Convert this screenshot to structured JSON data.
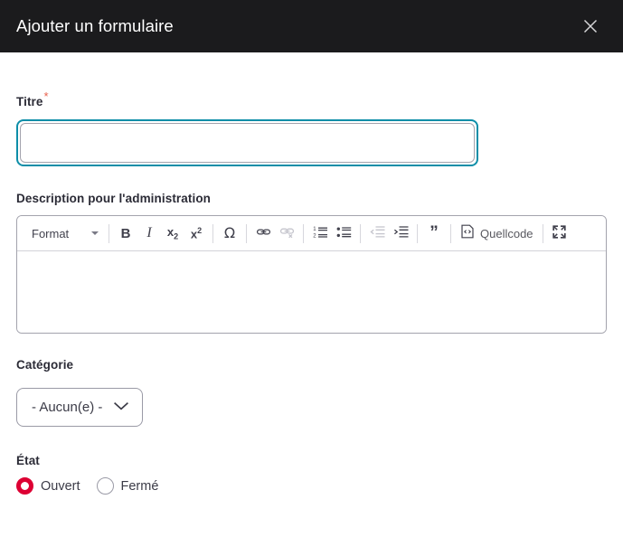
{
  "dialog": {
    "title": "Ajouter un formulaire",
    "close_label": "Fermer",
    "close_icon": "close-icon"
  },
  "colors": {
    "header_bg": "#1b1b1d",
    "focus_ring": "#0d8ea8",
    "required_star": "#e8604c",
    "radio_selected": "#dd0033",
    "border_grey": "#a3a3ad"
  },
  "form": {
    "title_field": {
      "label": "Titre",
      "required_marker": "*",
      "value": "",
      "placeholder": ""
    },
    "description_field": {
      "label": "Description pour l'administration",
      "value": "",
      "toolbar": {
        "format_label": "Format",
        "format_caret_icon": "chevron-down-icon",
        "buttons": [
          {
            "name": "bold",
            "label": "B",
            "icon": "bold-icon",
            "disabled": false
          },
          {
            "name": "italic",
            "label": "I",
            "icon": "italic-icon",
            "disabled": false
          },
          {
            "name": "subscript",
            "label": "x2",
            "icon": "subscript-icon",
            "disabled": false
          },
          {
            "name": "superscript",
            "label": "x2",
            "icon": "superscript-icon",
            "disabled": false
          },
          {
            "name": "special-char",
            "label": "Ω",
            "icon": "omega-icon",
            "disabled": false
          },
          {
            "name": "link",
            "label": "",
            "icon": "link-icon",
            "disabled": false
          },
          {
            "name": "unlink",
            "label": "",
            "icon": "unlink-icon",
            "disabled": true
          },
          {
            "name": "numbered-list",
            "label": "",
            "icon": "numbered-list-icon",
            "disabled": false
          },
          {
            "name": "bulleted-list",
            "label": "",
            "icon": "bulleted-list-icon",
            "disabled": false
          },
          {
            "name": "outdent",
            "label": "",
            "icon": "outdent-icon",
            "disabled": true
          },
          {
            "name": "indent",
            "label": "",
            "icon": "indent-icon",
            "disabled": false
          },
          {
            "name": "blockquote",
            "label": "”",
            "icon": "blockquote-icon",
            "disabled": false
          }
        ],
        "source_label": "Quellcode",
        "source_icon": "source-code-icon",
        "maximize_icon": "maximize-icon"
      }
    },
    "category_field": {
      "label": "Catégorie",
      "selected": "- Aucun(e) -",
      "caret_icon": "chevron-down-icon",
      "options": [
        "- Aucun(e) -"
      ]
    },
    "state_field": {
      "label": "État",
      "options": [
        {
          "label": "Ouvert",
          "selected": true
        },
        {
          "label": "Fermé",
          "selected": false
        }
      ]
    }
  }
}
